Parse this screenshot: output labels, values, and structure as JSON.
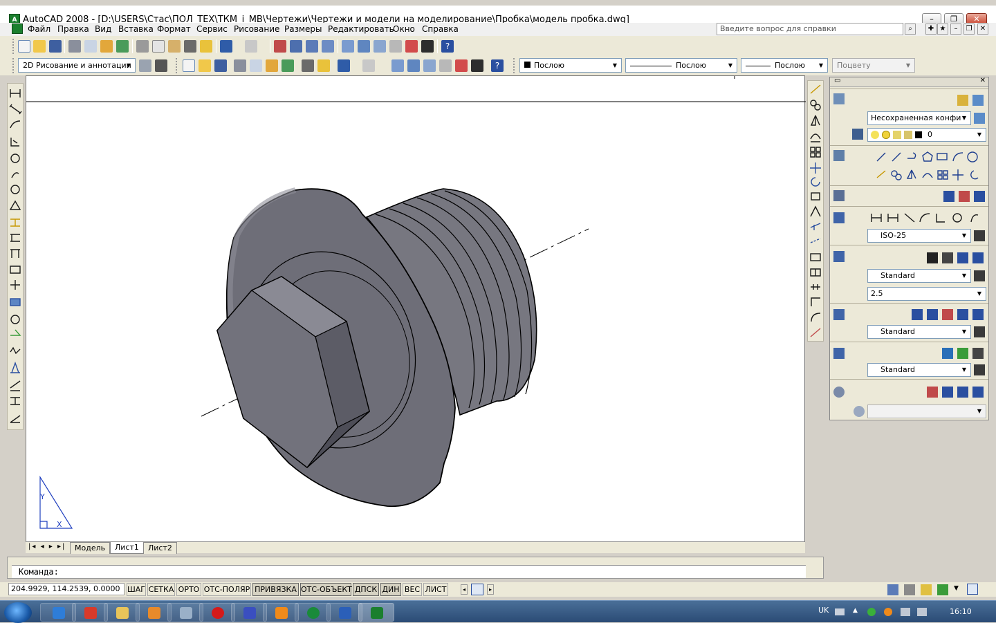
{
  "window": {
    "title": "AutoCAD 2008 - [D:\\USERS\\Стас\\ПОЛ_ТЕХ\\ТКМ_i_МВ\\Чертежи\\Чертежи и модели на моделирование\\Пробка\\модель пробка.dwg]"
  },
  "menu": [
    "Файл",
    "Правка",
    "Вид",
    "Вставка",
    "Формат",
    "Сервис",
    "Рисование",
    "Размеры",
    "Редактировать",
    "Окно",
    "Справка"
  ],
  "help_search": {
    "placeholder": "Введите вопрос для справки"
  },
  "toolbar2": {
    "workspace": "2D Рисование и аннотации",
    "color": "Послою",
    "linetype": "Послою",
    "lineweight": "Послою",
    "plotstyle": "Поцвету"
  },
  "layout_tabs": [
    "Модель",
    "Лист1",
    "Лист2"
  ],
  "command": {
    "prompt": "Команда:"
  },
  "status": {
    "coords": "204.9929, 114.2539, 0.0000",
    "toggles": [
      "ШАГ",
      "СЕТКА",
      "ОРТО",
      "ОТС-ПОЛЯР",
      "ПРИВЯЗКА",
      "ОТС-ОБЪЕКТ",
      "ДПСК",
      "ДИН",
      "ВЕС",
      "ЛИСТ"
    ]
  },
  "dashboard": {
    "layer_state": "Несохраненная конфи",
    "layer": "0",
    "dim_style": "ISO-25",
    "text_style": "Standard",
    "text_height": "2.5",
    "mleader_style": "Standard",
    "table_style": "Standard"
  },
  "ucs": {
    "y": "Y",
    "x": "X"
  },
  "taskbar": {
    "lang": "UK",
    "clock": "16:10"
  },
  "colors": {
    "titlebar_close": "#c8412a",
    "model_fill": "#6e6e78",
    "taskbar": "#2b4b75"
  }
}
